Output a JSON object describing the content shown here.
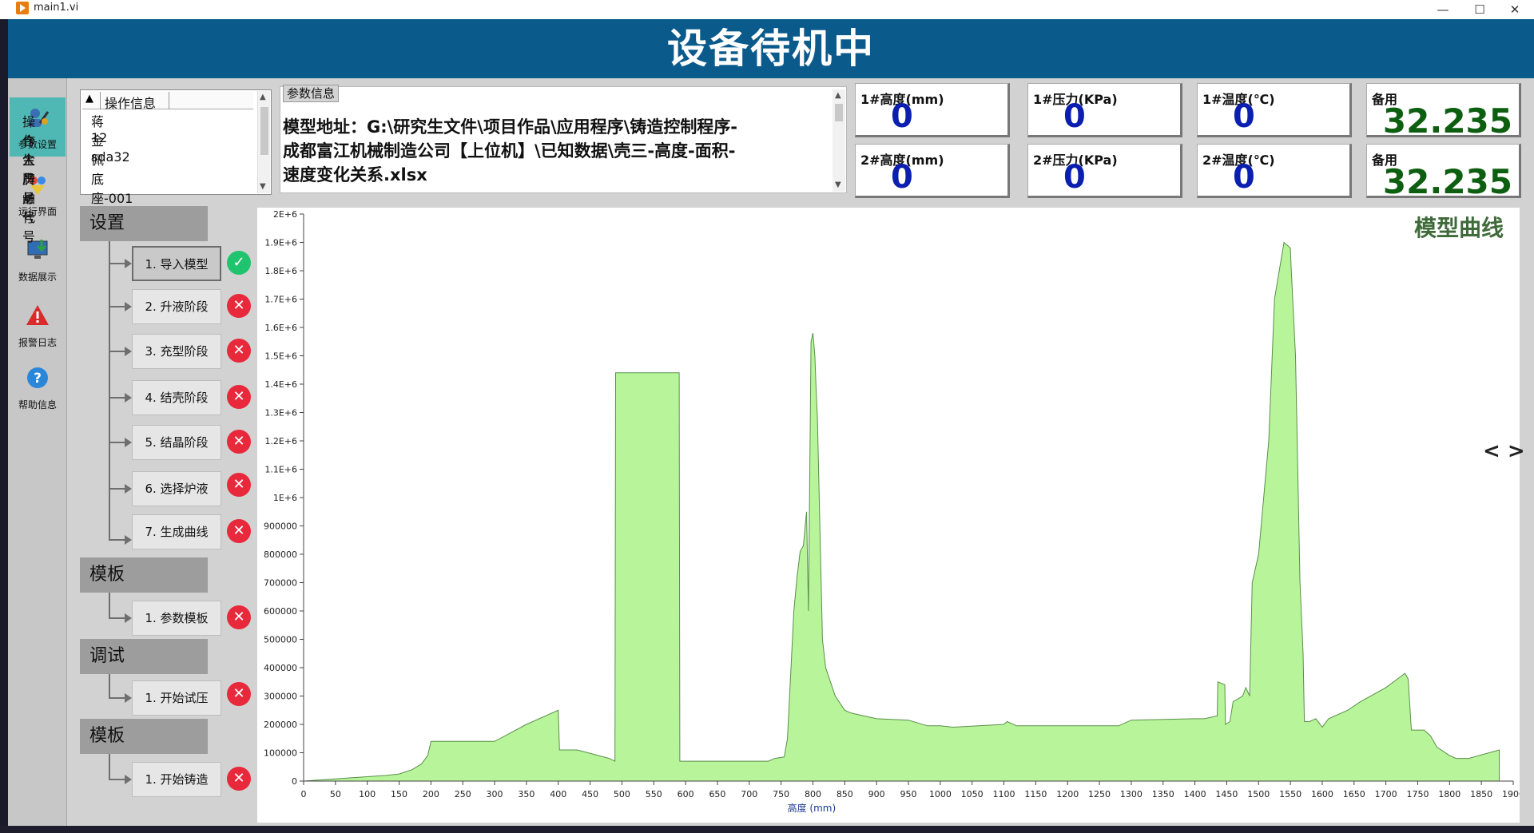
{
  "window": {
    "title": "main1.vi",
    "minimize": "—",
    "maximize": "☐",
    "close": "✕"
  },
  "header": {
    "title": "设备待机中"
  },
  "nav": {
    "items": [
      {
        "label": "参数设置",
        "icon": "settings-user-icon",
        "active": true
      },
      {
        "label": "运行界面",
        "icon": "run-icon"
      },
      {
        "label": "数据展示",
        "icon": "monitor-download-icon"
      },
      {
        "label": "报警日志",
        "icon": "alarm-icon"
      },
      {
        "label": "帮助信息",
        "icon": "help-icon"
      }
    ]
  },
  "operator": {
    "header": "操作信息",
    "rows": [
      {
        "key": "操作人员",
        "value": "蒋金佩"
      },
      {
        "key": "合金牌号",
        "value": "12"
      },
      {
        "key": "生产炉号",
        "value": "sda32"
      },
      {
        "key": "产品代号",
        "value": "底座-001"
      }
    ]
  },
  "params": {
    "label": "参数信息",
    "line1": "模型地址：G:\\研究生文件\\项目作品\\应用程序\\铸造控制程序-",
    "line2": "成都富江机械制造公司【上位机】\\已知数据\\壳三-高度-面积-",
    "line3": "速度变化关系.xlsx"
  },
  "indicators": [
    {
      "label": "1#高度(mm)",
      "value": "0"
    },
    {
      "label": "1#压力(KPa)",
      "value": "0"
    },
    {
      "label": "1#温度(℃)",
      "value": "0"
    },
    {
      "label": "备用",
      "value": "32.235"
    },
    {
      "label": "2#高度(mm)",
      "value": "0"
    },
    {
      "label": "2#压力(KPa)",
      "value": "0"
    },
    {
      "label": "2#温度(℃)",
      "value": "0"
    },
    {
      "label": "备用",
      "value": "32.235"
    }
  ],
  "sections": [
    {
      "title": "设置",
      "steps": [
        {
          "label": "1.  导入模型",
          "status": "ok",
          "status_glyph": "✓"
        },
        {
          "label": "2.  升液阶段",
          "status": "err",
          "status_glyph": "✕"
        },
        {
          "label": "3.  充型阶段",
          "status": "err",
          "status_glyph": "✕"
        },
        {
          "label": "4.  结壳阶段",
          "status": "err",
          "status_glyph": "✕"
        },
        {
          "label": "5.  结晶阶段",
          "status": "err",
          "status_glyph": "✕"
        },
        {
          "label": "6.  选择炉液",
          "status": "err",
          "status_glyph": "✕"
        },
        {
          "label": "7.  生成曲线",
          "status": "err",
          "status_glyph": "✕"
        }
      ]
    },
    {
      "title": "模板",
      "steps": [
        {
          "label": "1.  参数模板",
          "status": "err",
          "status_glyph": "✕"
        }
      ]
    },
    {
      "title": "调试",
      "steps": [
        {
          "label": "1.  开始试压",
          "status": "err",
          "status_glyph": "✕"
        }
      ]
    },
    {
      "title": "模板",
      "steps": [
        {
          "label": "1.  开始铸造",
          "status": "err",
          "status_glyph": "✕"
        }
      ]
    }
  ],
  "chart_nav": "< >",
  "chart_data": {
    "type": "area",
    "title": "模型曲线",
    "xlabel": "高度 (mm)",
    "ylabel": "",
    "xlim": [
      0,
      1900
    ],
    "ylim": [
      0,
      2000000
    ],
    "fill_color": "#b8f59a",
    "line_color": "#5a8f4a",
    "x_ticks": [
      0,
      50,
      100,
      150,
      200,
      250,
      300,
      350,
      400,
      450,
      500,
      550,
      600,
      650,
      700,
      750,
      800,
      850,
      900,
      950,
      1000,
      1050,
      1100,
      1150,
      1200,
      1250,
      1300,
      1350,
      1400,
      1450,
      1500,
      1550,
      1600,
      1650,
      1700,
      1750,
      1800,
      1850,
      1900
    ],
    "y_ticks": [
      {
        "v": 0,
        "label": "0"
      },
      {
        "v": 100000,
        "label": "100000"
      },
      {
        "v": 200000,
        "label": "200000"
      },
      {
        "v": 300000,
        "label": "300000"
      },
      {
        "v": 400000,
        "label": "400000"
      },
      {
        "v": 500000,
        "label": "500000"
      },
      {
        "v": 600000,
        "label": "600000"
      },
      {
        "v": 700000,
        "label": "700000"
      },
      {
        "v": 800000,
        "label": "800000"
      },
      {
        "v": 900000,
        "label": "900000"
      },
      {
        "v": 1000000,
        "label": "1E+6"
      },
      {
        "v": 1100000,
        "label": "1.1E+6"
      },
      {
        "v": 1200000,
        "label": "1.2E+6"
      },
      {
        "v": 1300000,
        "label": "1.3E+6"
      },
      {
        "v": 1400000,
        "label": "1.4E+6"
      },
      {
        "v": 1500000,
        "label": "1.5E+6"
      },
      {
        "v": 1600000,
        "label": "1.6E+6"
      },
      {
        "v": 1700000,
        "label": "1.7E+6"
      },
      {
        "v": 1800000,
        "label": "1.8E+6"
      },
      {
        "v": 1900000,
        "label": "1.9E+6"
      },
      {
        "v": 2000000,
        "label": "2E+6"
      }
    ],
    "x": [
      0,
      130,
      150,
      170,
      185,
      195,
      200,
      230,
      280,
      300,
      350,
      400,
      402,
      430,
      480,
      489,
      490,
      590,
      591,
      600,
      700,
      730,
      740,
      755,
      760,
      770,
      775,
      780,
      785,
      790,
      793,
      797,
      800,
      803,
      805,
      807,
      815,
      820,
      835,
      850,
      860,
      880,
      900,
      950,
      980,
      1000,
      1020,
      1100,
      1105,
      1120,
      1200,
      1280,
      1300,
      1400,
      1415,
      1435,
      1436,
      1447,
      1448,
      1455,
      1460,
      1475,
      1480,
      1486,
      1490,
      1500,
      1516,
      1525,
      1540,
      1550,
      1551,
      1558,
      1565,
      1570,
      1572,
      1580,
      1590,
      1600,
      1610,
      1640,
      1660,
      1700,
      1730,
      1735,
      1740,
      1760,
      1770,
      1780,
      1800,
      1810,
      1830,
      1878
    ],
    "y": [
      0,
      20000,
      25000,
      40000,
      60000,
      90000,
      140000,
      140000,
      140000,
      140000,
      200000,
      250000,
      110000,
      110000,
      80000,
      70000,
      1440000,
      1440000,
      70000,
      70000,
      70000,
      70000,
      80000,
      85000,
      150000,
      600000,
      720000,
      810000,
      830000,
      950000,
      600000,
      1550000,
      1580000,
      1500000,
      1380000,
      1280000,
      500000,
      400000,
      300000,
      250000,
      240000,
      230000,
      220000,
      215000,
      195000,
      195000,
      190000,
      200000,
      210000,
      195000,
      195000,
      195000,
      215000,
      220000,
      220000,
      230000,
      350000,
      340000,
      200000,
      210000,
      280000,
      300000,
      330000,
      300000,
      700000,
      800000,
      1200000,
      1700000,
      1900000,
      1880000,
      1820000,
      1500000,
      700000,
      450000,
      210000,
      210000,
      220000,
      190000,
      220000,
      250000,
      280000,
      330000,
      380000,
      360000,
      180000,
      180000,
      160000,
      120000,
      90000,
      80000,
      80000,
      110000
    ]
  }
}
